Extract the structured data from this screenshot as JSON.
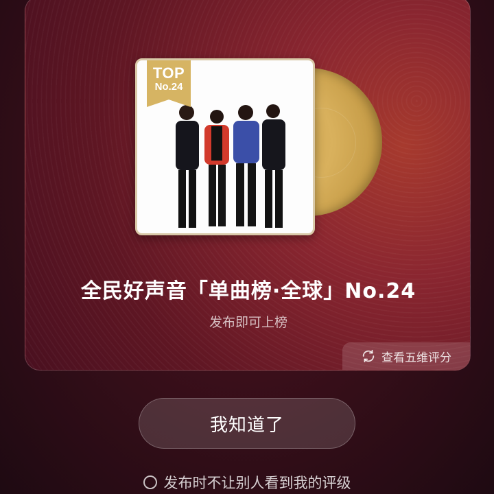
{
  "card": {
    "badge": {
      "top": "TOP",
      "rank": "No.24"
    },
    "title": "全民好声音「单曲榜·全球」No.24",
    "subtitle": "发布即可上榜",
    "five_dimension_label": "查看五维评分"
  },
  "confirm_button_label": "我知道了",
  "privacy_option_label": "发布时不让别人看到我的评级",
  "colors": {
    "gold": "#d6b463",
    "card_red": "#8a2630",
    "background": "#2a0c16"
  }
}
